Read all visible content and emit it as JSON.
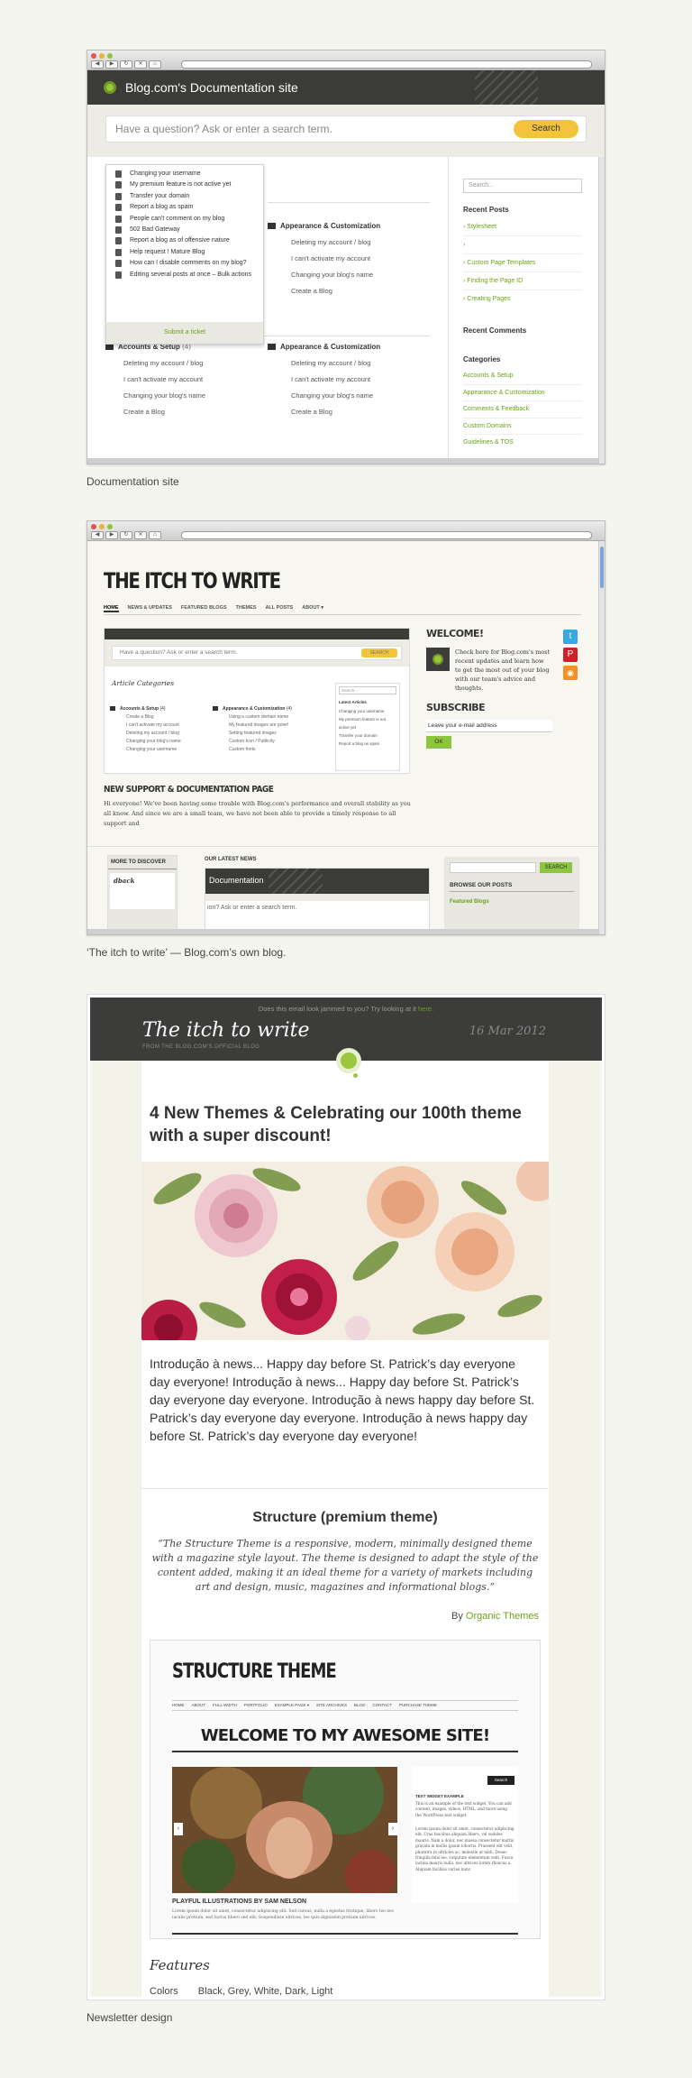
{
  "captions": {
    "docs": "Documentation site",
    "blog": "‘The itch to write’ — Blog.com’s own blog.",
    "newsletter": "Newsletter design"
  },
  "doc_site": {
    "title": "Blog.com's Documentation site",
    "search_placeholder": "Have a question? Ask or enter a search term.",
    "search_button": "Search",
    "suggestions": [
      "Changing your username",
      "My premium feature is not active yet",
      "Transfer your domain",
      "Report a blog as spam",
      "People can't comment on my blog",
      "502 Bad Gateway",
      "Report a blog as of offensive nature",
      "Help request ! Mature Blog",
      "How can I disable comments on my blog?",
      "Editing several posts at once – Bulk actions"
    ],
    "submit_ticket": "Submit a ticket",
    "section_appearance": "Appearance & Customization",
    "section_accounts": "Accounts & Setup",
    "accounts_count": "(4)",
    "appearance_items": [
      "Deleting my account / blog",
      "I can't activate my account",
      "Changing your blog's name",
      "Create a Blog"
    ],
    "accounts_items": [
      "Deleting my account / blog",
      "I can't activate my account",
      "Changing your blog's name",
      "Create a Blog"
    ],
    "sidebar_search": "Search...",
    "recent_posts_title": "Recent Posts",
    "recent_posts": [
      "Stylesheet",
      "",
      "Custom Page Templates",
      "Finding the Page ID",
      "Creating Pages"
    ],
    "recent_comments_title": "Recent Comments",
    "categories_title": "Categories",
    "categories": [
      "Accounts & Setup",
      "Appearance & Customization",
      "Comments & Feedback",
      "Custom Domains",
      "Guidelines & TOS"
    ]
  },
  "blog": {
    "title": "THE ITCH TO WRITE",
    "nav": [
      "HOME",
      "NEWS & UPDATES",
      "FEATURED BLOGS",
      "THEMES",
      "ALL POSTS",
      "ABOUT ▾"
    ],
    "search_placeholder": "Have a question? Ask or enter a search term.",
    "search_button": "SEARCH",
    "article_categories": "Article Categories",
    "cat_accounts": "Accounts & Setup",
    "cat_accounts_count": "(4)",
    "cat_appearance": "Appearance & Customization",
    "cat_appearance_count": "(4)",
    "accounts_items": [
      "Create a Blog",
      "I can't activate my account",
      "Deleting my account / blog",
      "Changing your blog's name",
      "Changing your username"
    ],
    "appearance_items": [
      "Using a custom domain name",
      "My featured images are gone!",
      "Setting featured images",
      "Custom Icon / Publicity",
      "Custom fonts"
    ],
    "search_small": "Search...",
    "latest_articles": "Latest Articles",
    "latest_items": [
      "Changing your username",
      "My premium feature is not active yet",
      "Transfer your domain",
      "Report a blog as spam"
    ],
    "welcome_title": "WELCOME!",
    "welcome_text": "Check here for Blog.com's most recent updates and learn how to get the most out of your blog with our team's advice and thoughts.",
    "subscribe_title": "SUBSCRIBE",
    "email_placeholder": "Leave your e-mail address",
    "ok": "OK",
    "post_title": "NEW SUPPORT & DOCUMENTATION PAGE",
    "post_text": "Hi everyone! We've been having some trouble with Blog.com's performance and overall stability as you all know. And since we are a small team, we have not been able to provide a timely response to all support and",
    "more_to_discover": "MORE TO DISCOVER",
    "discover_item": "dback",
    "latest_news": "OUR LATEST NEWS",
    "doc_label": "Documentation",
    "doc_search_stub": "ion? Ask or enter a search term.",
    "search_btn2": "SEARCH",
    "browse_posts": "BROWSE OUR POSTS",
    "featured_blogs": "Featured Blogs"
  },
  "newsletter": {
    "jammed": "Does this email look jammed to you? Try looking at it ",
    "here": "here.",
    "title": "The itch to write",
    "date": "16 Mar 2012",
    "subtitle": "FROM THE BLOG.COM'S OFFICIAL BLOG",
    "headline": "4 New Themes & Celebrating our 100th theme with a super discount!",
    "intro": "Introdução à news... Happy day before St. Patrick’s day everyone day everyone! Introdução à news... Happy day before St. Patrick’s day everyone day everyone. Introdução à news happy day before St. Patrick’s day everyone day everyone. Introdução à news happy day before St. Patrick’s day everyone day everyone!",
    "theme_name": "Structure (premium theme)",
    "quote": "“The Structure Theme is a responsive, modern, minimally designed theme with a magazine style layout. The theme is designed to adapt the style of the content added, making it an ideal theme for a variety of markets including art and design, music, magazines and informational blogs.”",
    "by": "By ",
    "author": "Organic Themes",
    "preview_title": "STRUCTURE THEME",
    "preview_nav": [
      "HOME",
      "ABOUT",
      "FULL WIDTH",
      "PORTFOLIO",
      "EXAMPLE PAGE ▾",
      "SITE ARCHIVES",
      "BLOG",
      "CONTACT",
      "PURCHASE THEME"
    ],
    "preview_welcome": "WELCOME TO MY AWESOME SITE!",
    "preview_search": "Search",
    "widget_title": "TEXT WIDGET EXAMPLE",
    "widget_text": "This is an example of the text widget. You can add content, images, videos, HTML, and more using the WordPress text widget.",
    "widget_lorem": "Lorem ipsum dolor sit amet, consectetur adipiscing elit. Cras faucibus aliquam libero, vel sodales mauris. Nam a dolor, nec massa consectetur mattis gravida in mollis ipsum lobortis. Praesent elit velit, pharetra in ultricies ac, molestie at nibh. Donec fringilla felis leo, vulputate elementum velit. Fusce lacinia mauris nulla, nec ultrices lorem rhoncus a. Aliquam facilisis varius nunc.",
    "caption": "PLAYFUL ILLUSTRATIONS BY SAM NELSON",
    "caption_text": "Lorem ipsum dolor sit amet, consectetur adipiscing elit. Sed cursus, nulla a egestas tristique, libero leo nec iaculis pretium, sed luctus libero sed elit. Suspendisse ultrices, leo quis dignissim pretium ultrices.",
    "features": "Features",
    "colors_label": "Colors",
    "colors_value": "Black, Grey, White, Dark, Light"
  }
}
